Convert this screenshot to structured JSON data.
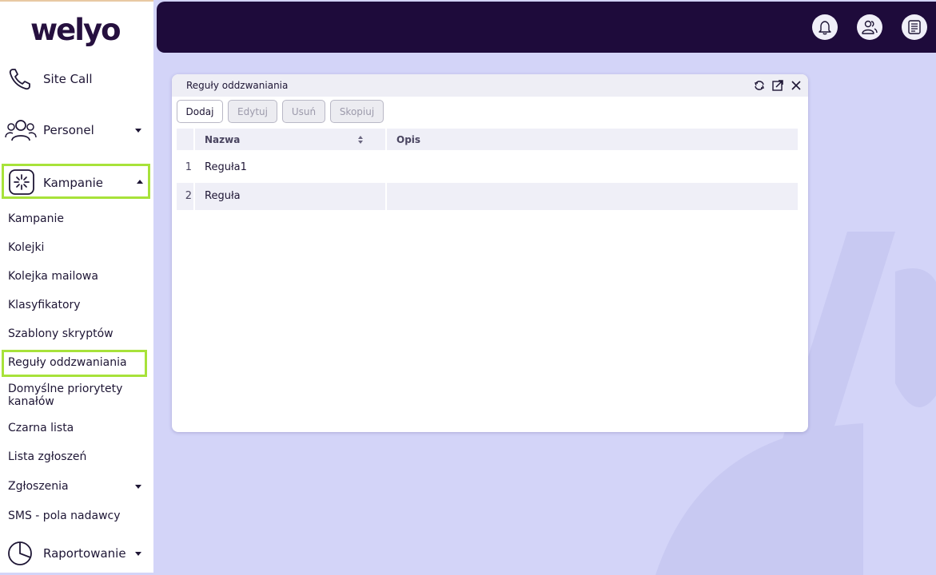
{
  "brand": {
    "logo": "welyo"
  },
  "sidebar": {
    "items": [
      {
        "label": "Site Call",
        "icon": "phone-icon"
      },
      {
        "label": "Personel",
        "icon": "users-icon"
      },
      {
        "label": "Kampanie",
        "icon": "campaign-icon"
      },
      {
        "label": "Raportowanie",
        "icon": "pie-chart-icon"
      }
    ],
    "subitems": [
      "Kampanie",
      "Kolejki",
      "Kolejka mailowa",
      "Klasyfikatory",
      "Szablony skryptów",
      "Reguły oddzwaniania",
      "Domyślne priorytety kanałów",
      "Czarna lista",
      "Lista zgłoszeń",
      "Zgłoszenia",
      "SMS - pola nadawcy"
    ]
  },
  "topbar": {
    "icons": [
      "bell-icon",
      "user-group-icon",
      "notes-icon"
    ]
  },
  "panel": {
    "title": "Reguły oddzwaniania",
    "toolbar": {
      "add": "Dodaj",
      "edit": "Edytuj",
      "delete": "Usuń",
      "copy": "Skopiuj"
    },
    "columns": [
      "Nazwa",
      "Opis"
    ],
    "rows": [
      {
        "num": "1",
        "name": "Reguła1",
        "desc": ""
      },
      {
        "num": "2",
        "name": "Reguła",
        "desc": ""
      }
    ]
  },
  "colors": {
    "accent_highlight": "#a7e23a",
    "topbar": "#1e0b3b",
    "background": "#d3d4f8"
  }
}
